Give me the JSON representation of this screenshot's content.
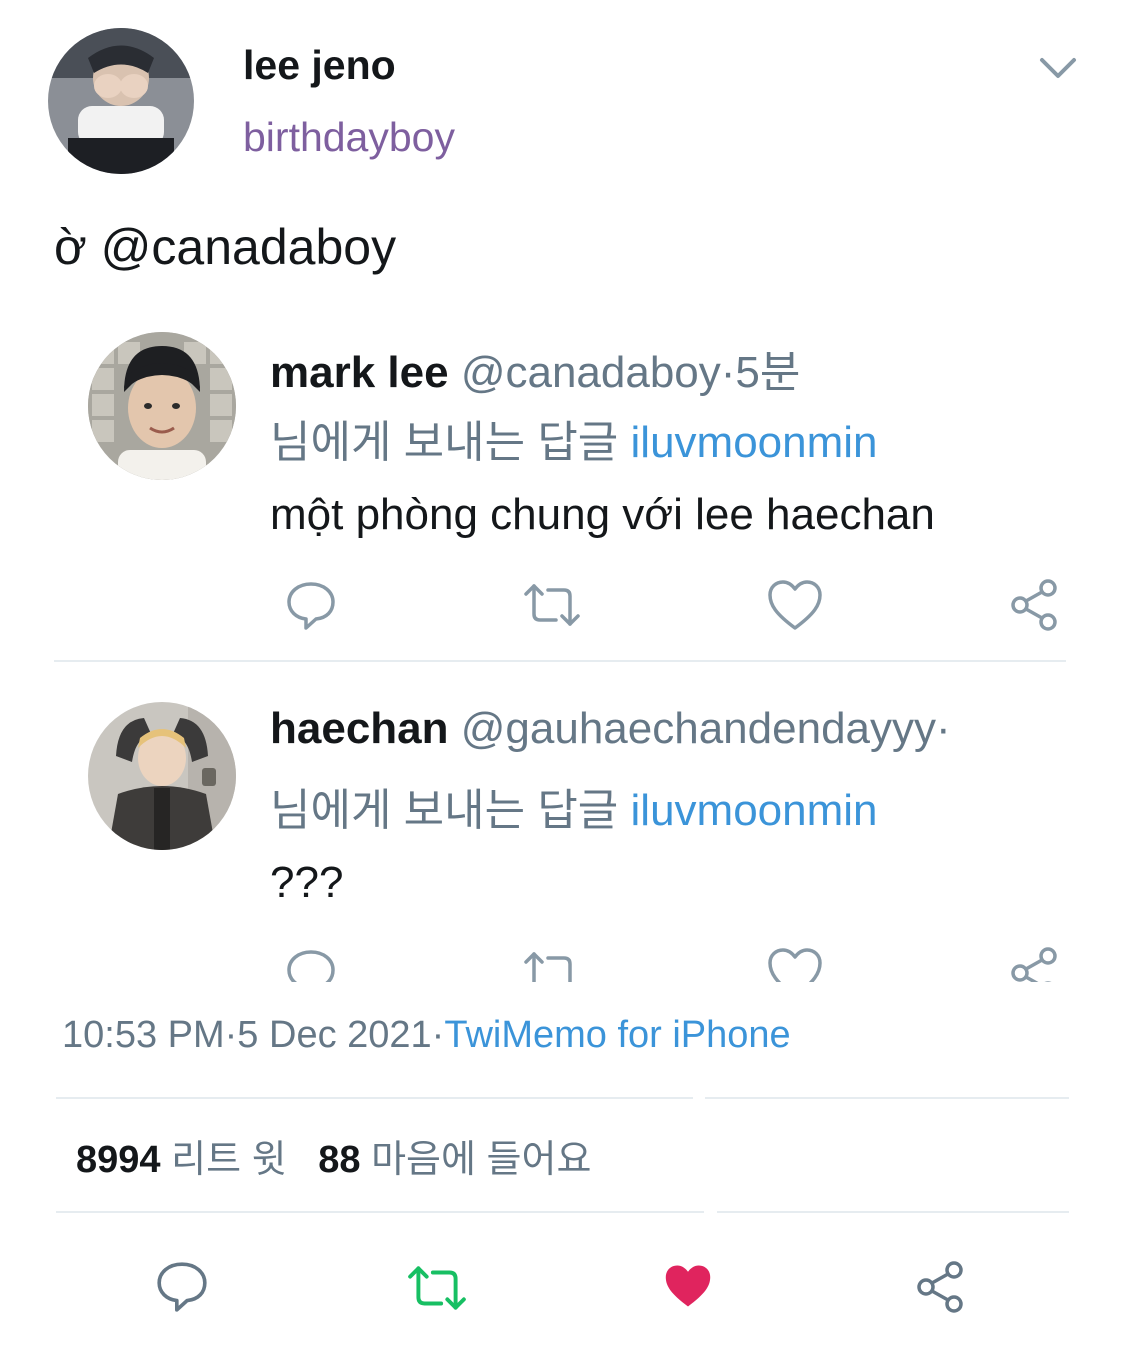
{
  "main_tweet": {
    "display_name": "lee jeno",
    "handle": "birthdayboy",
    "text": "ờ @canadaboy"
  },
  "replies": [
    {
      "display_name": "mark lee",
      "handle": "@canadaboy",
      "time": "·5분",
      "replying_prefix": "님에게 보내는 답글",
      "replying_to": "iluvmoonmin",
      "text": "một phòng chung với lee haechan"
    },
    {
      "display_name": "haechan",
      "handle": "@gauhaechandendayyy·",
      "replying_prefix": "님에게 보내는 답글",
      "replying_to": "iluvmoonmin",
      "text": "???"
    }
  ],
  "meta": {
    "time": "10:53 PM",
    "date": "·5 Dec 2021·",
    "source": "TwiMemo for iPhone"
  },
  "stats": {
    "retweets_count": "8994",
    "retweets_label": "리트 윗",
    "likes_count": "88",
    "likes_label": "마음에 들어요"
  },
  "icons": {
    "reply": "reply-icon",
    "retweet": "retweet-icon",
    "like": "heart-icon",
    "share": "share-icon",
    "menu": "chevron-down-icon"
  },
  "colors": {
    "retweet_active": "#17bf63",
    "like_active": "#e0245e",
    "handle_purple": "#7e5f9f",
    "mention_blue": "#3b94d9"
  }
}
